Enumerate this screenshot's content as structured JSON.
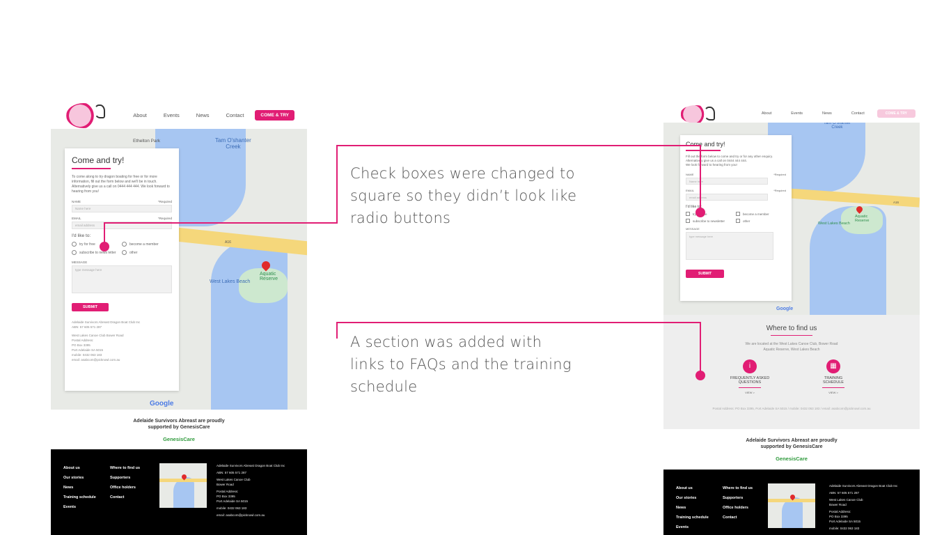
{
  "left_mockup": {
    "nav": {
      "links": [
        "About",
        "Events",
        "News",
        "Contact"
      ],
      "cta": "COME & TRY"
    },
    "map_labels": {
      "park": "Ethelton Park",
      "creek": "Tam O'shanter\nCreek",
      "beach": "West Lakes Beach",
      "reserve": "Aquatic\nReserve",
      "road": "A16",
      "google": "Google"
    },
    "form": {
      "title": "Come and try!",
      "intro": "To come along to try dragon boating for free or for more information, fill out the form below and we'll be in touch. Alternatively give us a call on 0444 444 444. We look forward to hearing from you!",
      "name_label": "NAME",
      "name_required": "*Required",
      "name_placeholder": "Name here",
      "email_label": "EMAIL",
      "email_required": "*Required",
      "email_placeholder": "email address",
      "like_label": "I'd like to:",
      "options": [
        "try for free",
        "become a member",
        "subscribe to news letter",
        "other"
      ],
      "message_label": "MESSAGE",
      "message_placeholder": "type message here",
      "submit": "SUBMIT",
      "club": "Adelaide Survivors Abreast Dragon Boat Club Inc",
      "abn": "ABN: 57 605 571 287",
      "venue": "West Lakes Canoe Club Bower Road",
      "postal": "Postal Address:\nPO Box 3395\nPort Adelaide SA 5015",
      "mobile": "mobile: 0432 063 183",
      "email": "email: asabcom@picknowl.com.au"
    },
    "sponsor": {
      "text": "Adelaide Survivors Abreast are proudly\nsupported by GenesisCare",
      "logo": "GenesisCare"
    },
    "footer": {
      "col1": [
        "About us",
        "Our stories",
        "News",
        "Training schedule",
        "Events"
      ],
      "col2": [
        "Where to find us",
        "Supporters",
        "Office holders",
        "Contact"
      ],
      "info": [
        "Adelaide Survivors Abreast Dragon Boat Club Inc",
        "ABN: 57 605 571 287",
        "West Lakes Canoe Club\nBower Road",
        "Postal Address:\nPO Box 3395\nPort Adelaide SA 5015",
        "mobile: 0432 063 183",
        "email: asabcom@picknowl.com.au"
      ]
    }
  },
  "right_mockup": {
    "nav": {
      "links": [
        "About",
        "Events",
        "News",
        "Contact"
      ],
      "cta": "COME & TRY"
    },
    "form": {
      "title": "Come and try!",
      "intro": "Fill out the form below to come and try or for any other enquiry. Alternatively give us a call on 0444 444 444.\nWe look forward to hearing from you!",
      "name_label": "NAME",
      "name_required": "*Required",
      "name_placeholder": "Name here",
      "email_label": "EMAIL",
      "email_required": "*Required",
      "email_placeholder": "email address",
      "like_label": "I'd like to:",
      "options": [
        "try for free",
        "become a member",
        "subscribe to newsletter",
        "other"
      ],
      "message_label": "MESSAGE",
      "message_placeholder": "type message here",
      "submit": "SUBMIT"
    },
    "map_labels": {
      "creek": "Tam O'shanter\nCreek",
      "beach": "West Lakes Beach",
      "reserve": "Aquatic\nReserve",
      "google": "Google",
      "road": "A16"
    },
    "find_us": {
      "title": "Where to find us",
      "address": "We are located at the West Lakes Canoe Club, Bower Road\nAquatic Reserve, West Lakes Beach",
      "links": [
        {
          "label": "FREQUENTLY ASKED\nQUESTIONS",
          "view": "VIEW >",
          "icon": "info-icon"
        },
        {
          "label": "TRAINING\nSCHEDULE",
          "view": "VIEW >",
          "icon": "calendar-icon"
        }
      ],
      "postal": "Postal Address: PO Box 3395, Port Adelaide SA 5015  /  mobile: 0432 063 183  /  email: asabcom@picknowl.com.au"
    },
    "sponsor": {
      "text": "Adelaide Survivors Abreast are proudly\nsupported by GenesisCare",
      "logo": "GenesisCare"
    },
    "footer": {
      "col1": [
        "About us",
        "Our stories",
        "News",
        "Training schedule",
        "Events"
      ],
      "col2": [
        "Where to find us",
        "Supporters",
        "Office holders",
        "Contact"
      ],
      "info": [
        "Adelaide Survivors Abreast Dragon Boat Club Inc",
        "ABN: 57 605 571 287",
        "West Lakes Canoe Club\nBower Road",
        "Postal Address:\nPO Box 3395\nPort Adelaide SA 5015",
        "mobile: 0432 063 183"
      ]
    }
  },
  "annotations": {
    "note1": "Check boxes were changed to square so they didn’t look like radio buttons",
    "note2": "A section was added with links to FAQs and the training schedule"
  },
  "colors": {
    "accent": "#e11d74",
    "water": "#a7c6f2",
    "road": "#f5d77b"
  }
}
